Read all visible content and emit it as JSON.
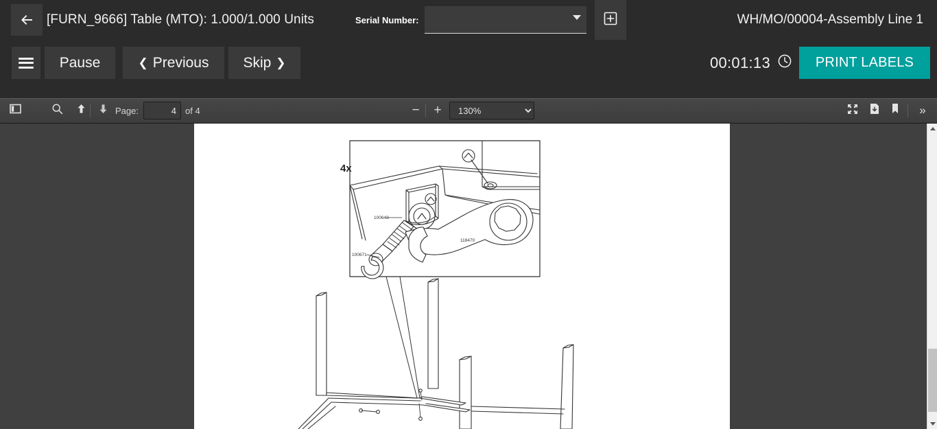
{
  "header": {
    "back_icon": "arrow-left-icon",
    "document_title": "[FURN_9666] Table (MTO): 1.000/1.000 Units",
    "serial_label": "Serial Number:",
    "serial_value": "",
    "serial_placeholder": "",
    "serial_dropdown_icon": "chevron-down-icon",
    "add_serial_icon": "plus-square-icon",
    "work_order_name": "WH/MO/00004-Assembly Line 1"
  },
  "actions": {
    "menu_icon": "hamburger-menu-icon",
    "pause_label": "Pause",
    "previous_label": "Previous",
    "previous_icon": "chevron-left-icon",
    "skip_label": "Skip",
    "skip_icon": "chevron-right-icon",
    "timer": "00:01:13",
    "timer_icon": "clock-icon",
    "print_labels_label": "PRINT LABELS",
    "accent_color": "#00a09d"
  },
  "pdf_toolbar": {
    "sidebar_toggle_icon": "sidebar-panel-icon",
    "find_icon": "search-icon",
    "previous_page_icon": "arrow-up-icon",
    "next_page_icon": "arrow-down-icon",
    "page_label": "Page:",
    "page_value": "4",
    "page_total": "of 4",
    "zoom_out_icon": "minus-icon",
    "zoom_out_label": "−",
    "zoom_in_icon": "plus-icon",
    "zoom_in_label": "+",
    "zoom_level": "130%",
    "zoom_options": [
      "130%"
    ],
    "presentation_icon": "fullscreen-icon",
    "download_icon": "download-icon",
    "bookmark_icon": "bookmark-icon",
    "more_tools_icon": "double-chevron-right-icon",
    "more_tools_label": "»"
  },
  "document": {
    "callout_multiplier": "4x",
    "part_label_bolt": "100643",
    "part_label_clip": "100671",
    "part_label_wrench": "118470"
  },
  "scrollbar": {
    "up_icon": "scroll-up-arrow-icon",
    "down_icon": "scroll-down-arrow-icon"
  }
}
